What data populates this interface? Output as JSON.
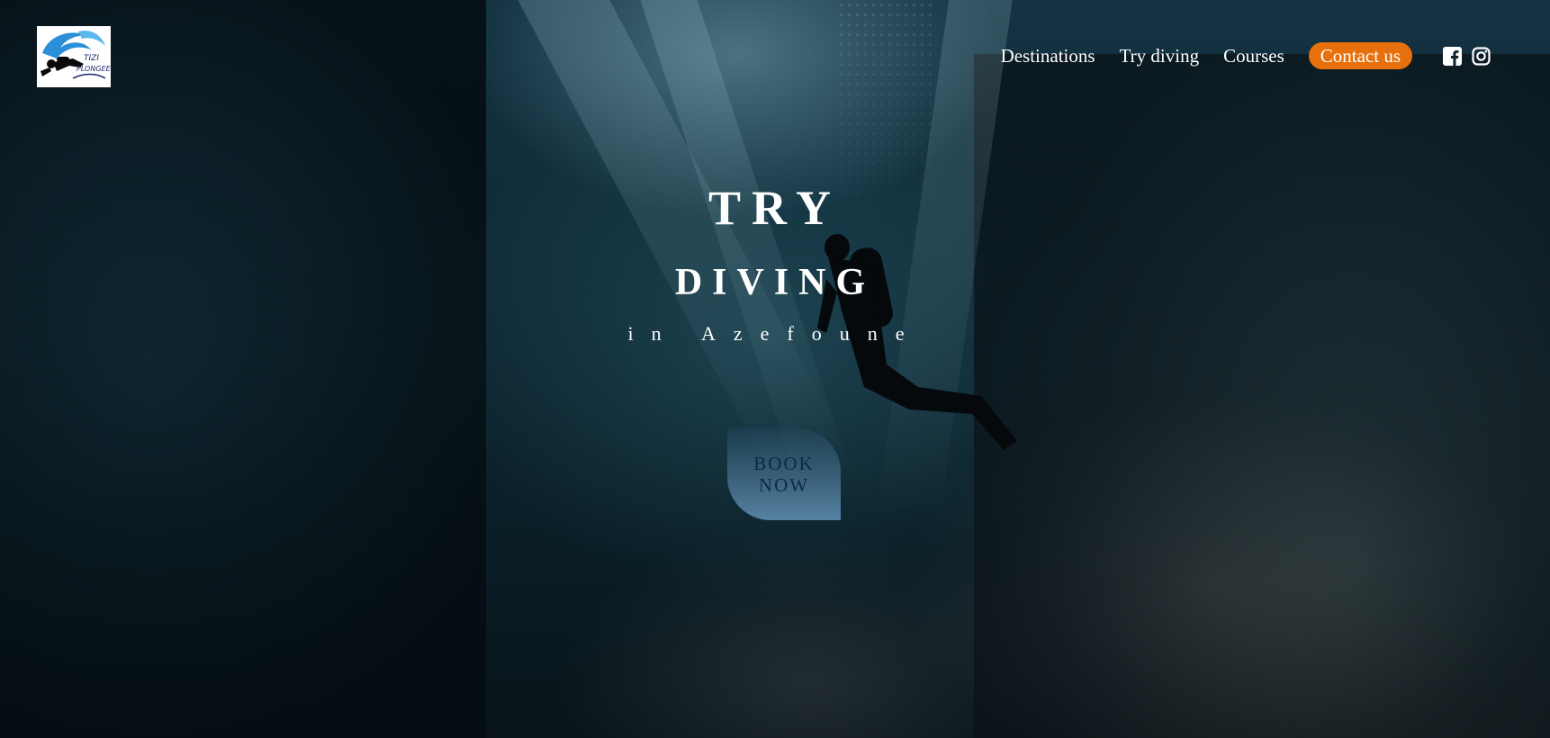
{
  "header": {
    "logo_text": "TIZI PLONGEE",
    "logo_icon": "diver-logo-icon"
  },
  "nav": {
    "links": [
      "Destinations",
      "Try diving",
      "Courses"
    ],
    "contact_label": "Contact us",
    "social": [
      {
        "icon": "facebook-icon"
      },
      {
        "icon": "instagram-icon"
      }
    ]
  },
  "hero": {
    "title_line1": "TRY",
    "title_line2": "DIVING",
    "subtitle": "in Azefoune",
    "cta_line1": "BOOK",
    "cta_line2": "NOW"
  },
  "colors": {
    "accent": "#e8700c",
    "text": "#ffffff",
    "cta_text": "#0c2a45"
  }
}
